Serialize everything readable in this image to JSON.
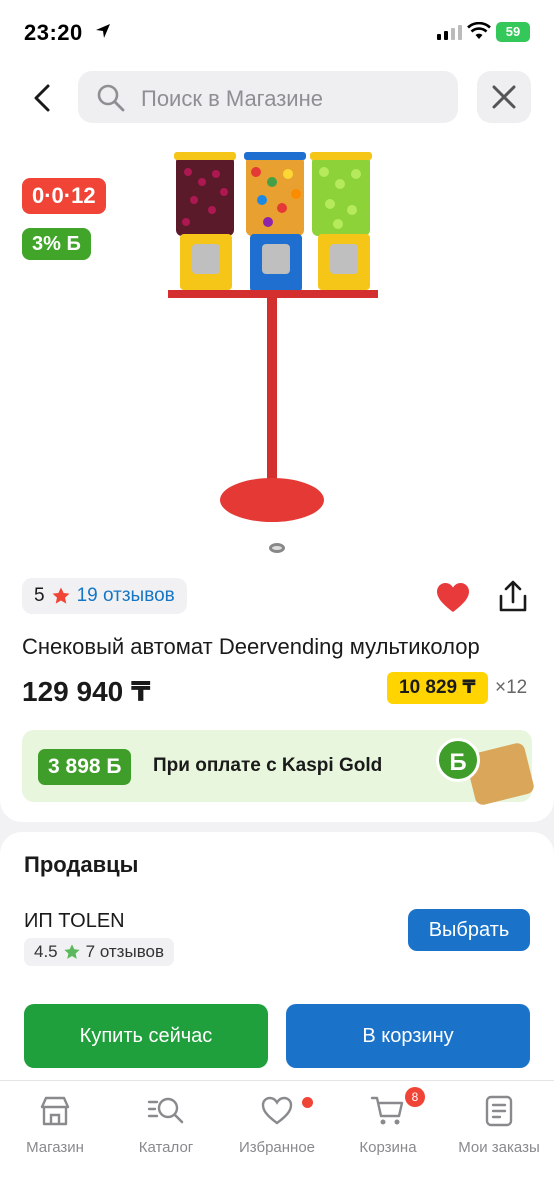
{
  "status_bar": {
    "time": "23:20",
    "battery": "59"
  },
  "search": {
    "placeholder": "Поиск в Магазине"
  },
  "product": {
    "timer_badge": "0·0·12",
    "bonus_badge": "3% Б",
    "rating": "5",
    "reviews_label": "19 отзывов",
    "title": "Снековый автомат Deervending мультиколор",
    "price": "129 940 ₸",
    "installment_price": "10 829 ₸",
    "installment_months": "×12",
    "kaspi_gold": {
      "bonus": "3 898 Б",
      "text": "При оплате с Kaspi Gold",
      "coin_letter": "Б"
    }
  },
  "sellers": {
    "heading": "Продавцы",
    "items": [
      {
        "name": "ИП TOLEN",
        "rating": "4.5",
        "reviews": "7 отзывов",
        "choose_label": "Выбрать"
      }
    ]
  },
  "actions": {
    "buy_now": "Купить сейчас",
    "add_to_cart": "В корзину"
  },
  "tabbar": {
    "items": [
      {
        "label": "Магазин",
        "icon": "store-icon"
      },
      {
        "label": "Каталог",
        "icon": "catalog-search-icon"
      },
      {
        "label": "Избранное",
        "icon": "heart-icon"
      },
      {
        "label": "Корзина",
        "icon": "cart-icon",
        "badge": "8"
      },
      {
        "label": "Мои заказы",
        "icon": "orders-icon"
      }
    ]
  },
  "colors": {
    "accent_blue": "#1a73c9",
    "buy_green": "#20a03d",
    "red": "#f04437",
    "yellow": "#ffd400"
  }
}
